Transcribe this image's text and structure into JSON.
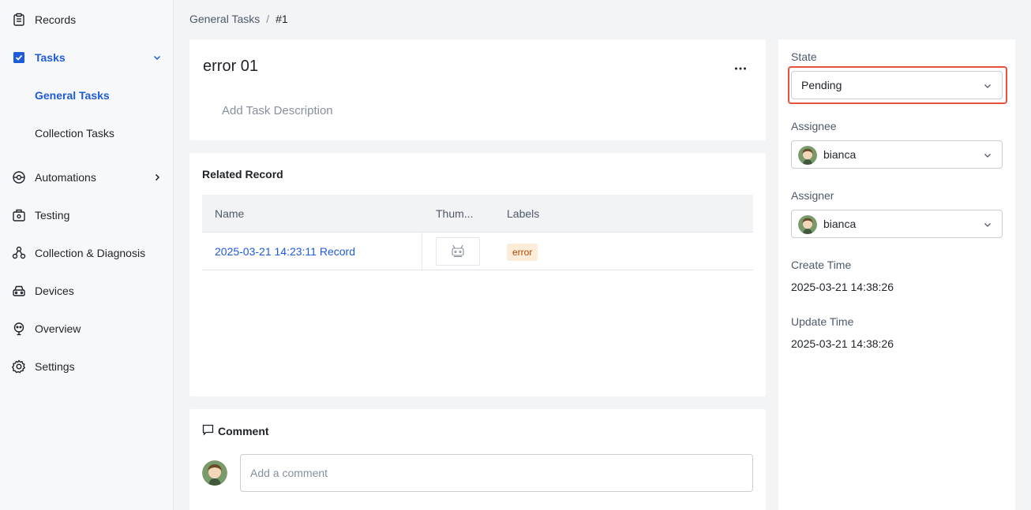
{
  "sidebar": {
    "items": [
      {
        "label": "Records",
        "icon": "clipboard-icon"
      },
      {
        "label": "Tasks",
        "icon": "task-icon"
      },
      {
        "label": "General Tasks"
      },
      {
        "label": "Collection Tasks"
      },
      {
        "label": "Automations",
        "icon": "automation-icon"
      },
      {
        "label": "Testing",
        "icon": "testing-icon"
      },
      {
        "label": "Collection & Diagnosis",
        "icon": "diagnosis-icon"
      },
      {
        "label": "Devices",
        "icon": "device-icon"
      },
      {
        "label": "Overview",
        "icon": "overview-icon"
      },
      {
        "label": "Settings",
        "icon": "gear-icon"
      }
    ]
  },
  "breadcrumb": {
    "parent": "General Tasks",
    "separator": "/",
    "current": "#1"
  },
  "task": {
    "title": "error 01",
    "description_placeholder": "Add Task Description"
  },
  "related": {
    "title": "Related Record",
    "columns": [
      "Name",
      "Thum...",
      "Labels"
    ],
    "rows": [
      {
        "name": "2025-03-21 14:23:11 Record",
        "label": "error"
      }
    ]
  },
  "comment": {
    "title": "Comment",
    "placeholder": "Add a comment"
  },
  "side": {
    "state_label": "State",
    "state_value": "Pending",
    "assignee_label": "Assignee",
    "assignee_value": "bianca",
    "assigner_label": "Assigner",
    "assigner_value": "bianca",
    "create_label": "Create Time",
    "create_value": "2025-03-21 14:38:26",
    "update_label": "Update Time",
    "update_value": "2025-03-21 14:38:26"
  },
  "colors": {
    "accent": "#1e5bd6",
    "tag_bg": "#fdecd8",
    "tag_text": "#b54708",
    "highlight": "#e5533d"
  }
}
